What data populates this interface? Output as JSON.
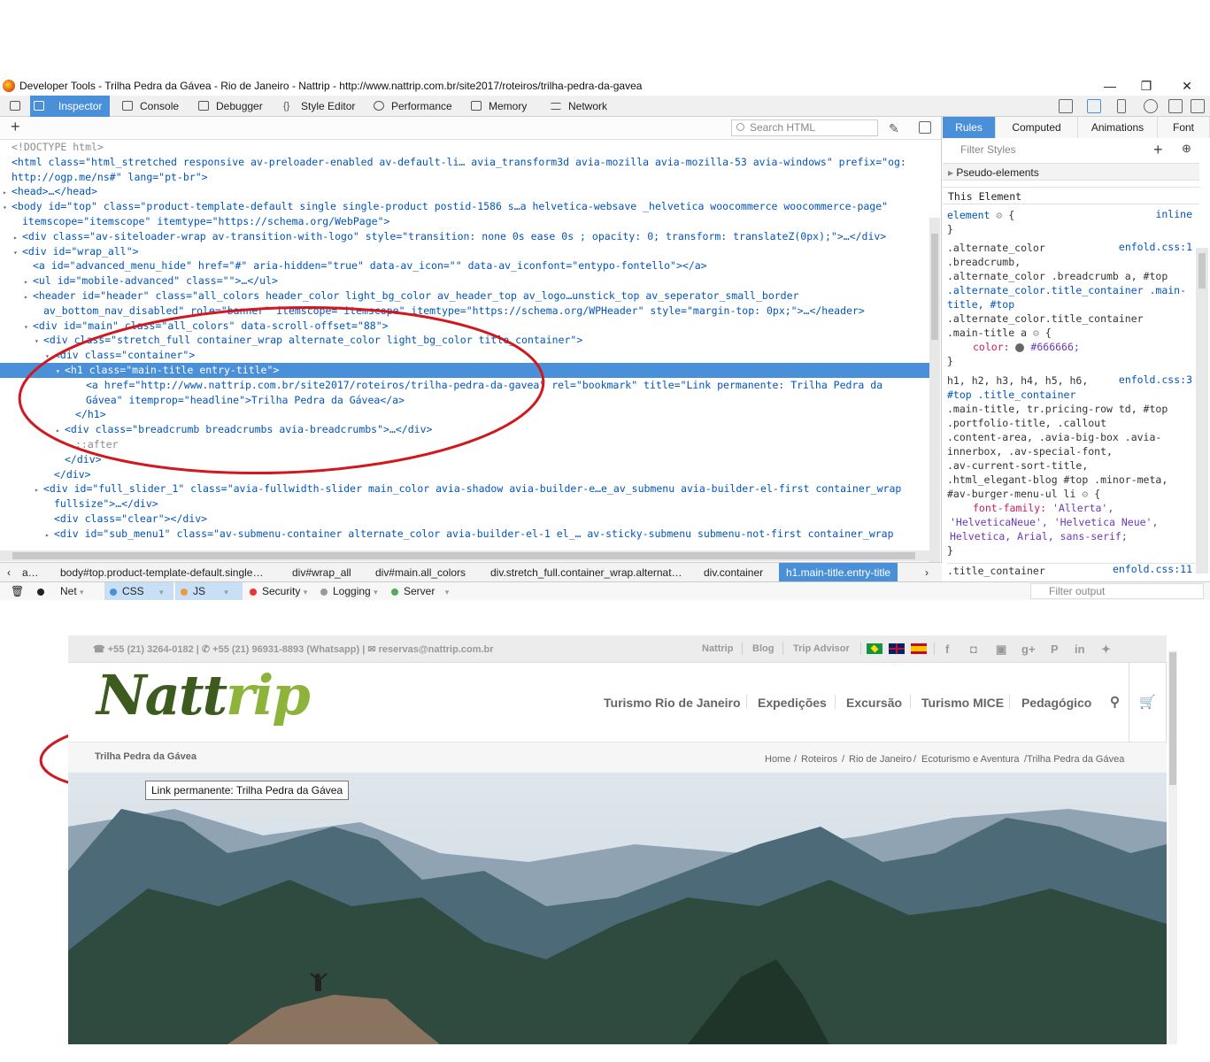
{
  "window": {
    "title": "Developer Tools - Trilha Pedra da Gávea - Rio de Janeiro - Nattrip - http://www.nattrip.com.br/site2017/roteiros/trilha-pedra-da-gavea"
  },
  "tabs": [
    "Inspector",
    "Console",
    "Debugger",
    "Style Editor",
    "Performance",
    "Memory",
    "Network"
  ],
  "markup": {
    "search_placeholder": "Search HTML",
    "lines": [
      {
        "t": "<!DOCTYPE html>"
      },
      {
        "t": "<html class=\"html_stretched responsive av-preloader-enabled av-default-li… avia_transform3d avia-mozilla avia-mozilla-53 avia-windows\" prefix=\"og:"
      },
      {
        "t": "http://ogp.me/ns#\" lang=\"pt-br\">"
      },
      {
        "t": "<head>…</head>"
      },
      {
        "t": "<body id=\"top\" class=\"product-template-default single single-product postid-1586 s…a helvetica-websave _helvetica woocommerce woocommerce-page\""
      },
      {
        "t": "itemscope=\"itemscope\" itemtype=\"https://schema.org/WebPage\">"
      },
      {
        "t": "<div class=\"av-siteloader-wrap av-transition-with-logo\" style=\"transition: none 0s ease 0s ; opacity: 0; transform: translateZ(0px);\">…</div>"
      },
      {
        "t": "<div id=\"wrap_all\">"
      },
      {
        "t": "<a id=\"advanced_menu_hide\" href=\"#\" aria-hidden=\"true\" data-av_icon=\"\" data-av_iconfont=\"entypo-fontello\"></a>"
      },
      {
        "t": "<ul id=\"mobile-advanced\" class=\"\">…</ul>"
      },
      {
        "t": "<header id=\"header\" class=\"all_colors header_color light_bg_color av_header_top av_logo…unstick_top av_seperator_small_border"
      },
      {
        "t": "av_bottom_nav_disabled\" role=\"banner\" itemscope=\"itemscope\" itemtype=\"https://schema.org/WPHeader\" style=\"margin-top: 0px;\">…</header>"
      },
      {
        "t": "<div id=\"main\" class=\"all_colors\" data-scroll-offset=\"88\">"
      },
      {
        "t": "<div class=\"stretch_full container_wrap alternate_color light_bg_color title_container\">"
      },
      {
        "t": "<div class=\"container\">"
      },
      {
        "t": "<h1 class=\"main-title entry-title\">"
      },
      {
        "t": "<a href=\"http://www.nattrip.com.br/site2017/roteiros/trilha-pedra-da-gavea\" rel=\"bookmark\" title=\"Link permanente: Trilha Pedra da"
      },
      {
        "t": "Gávea\" itemprop=\"headline\">Trilha Pedra da Gávea</a>"
      },
      {
        "t": "</h1>"
      },
      {
        "t": "<div class=\"breadcrumb breadcrumbs avia-breadcrumbs\">…</div>"
      },
      {
        "t": "::after"
      },
      {
        "t": "</div>"
      },
      {
        "t": "</div>"
      },
      {
        "t": "<div id=\"full_slider_1\" class=\"avia-fullwidth-slider main_color avia-shadow avia-builder-e…e_av_submenu avia-builder-el-first container_wrap"
      },
      {
        "t": "fullsize\">…</div>"
      },
      {
        "t": "<div class=\"clear\"></div>"
      },
      {
        "t": "<div id=\"sub_menu1\" class=\"av-submenu-container alternate_color avia-builder-el-1 el_… av-sticky-submenu submenu-not-first container_wrap"
      }
    ]
  },
  "rules": {
    "tabs": [
      "Rules",
      "Computed",
      "Animations",
      "Font"
    ],
    "filter_placeholder": "Filter Styles",
    "pseudo": "Pseudo-elements",
    "this_element": "This Element",
    "element": "element",
    "inline": "inline",
    "r1_src": "enfold.css:1",
    "r1_sel": [
      ".alternate_color",
      ".breadcrumb,",
      ".alternate_color .breadcrumb a, #top",
      ".alternate_color.title_container .main-",
      "title, #top",
      ".alternate_color.title_container",
      ".main-title a"
    ],
    "r1_prop": "color:",
    "r1_val": "#666666;",
    "r2_src": "enfold.css:3",
    "r2_sel": [
      "h1, h2, h3, h4, h5, h6,",
      "#top .title_container",
      ".main-title, tr.pricing-row td, #top",
      ".portfolio-title, .callout",
      ".content-area, .avia-big-box .avia-",
      "innerbox, .av-special-font,",
      ".av-current-sort-title,",
      ".html_elegant-blog #top .minor-meta,",
      "#av-burger-menu-ul li"
    ],
    "r2_prop": "font-family:",
    "r2_val": [
      "'Allerta',",
      "'HelveticaNeue', 'Helvetica Neue',",
      "Helvetica, Arial, sans-serif;"
    ],
    "r3_sel": ".title_container",
    "r3_src": "enfold.css:11"
  },
  "crumbs": [
    "a…",
    "body#top.product-template-default.single…",
    "div#wrap_all",
    "div#main.all_colors",
    "div.stretch_full.container_wrap.alternat…",
    "div.container",
    "h1.main-title.entry-title"
  ],
  "console": {
    "filters": [
      "Net",
      "CSS",
      "JS",
      "Security",
      "Logging",
      "Server"
    ],
    "filter_placeholder": "Filter output"
  },
  "site": {
    "contact": "☎ +55 (21) 3264-0182 | ✆ +55 (21) 96931-8893 (Whatsapp) | ✉ reservas@nattrip.com.br",
    "top_links": [
      "Nattrip",
      "Blog",
      "Trip Advisor"
    ],
    "logo_a": "Natt",
    "logo_b": "rip",
    "nav": [
      "Turismo Rio de Janeiro",
      "Expedições",
      "Excursão",
      "Turismo MICE",
      "Pedagógico"
    ],
    "page_title": "Trilha Pedra da Gávea",
    "breadcrumb": [
      "Home",
      "/",
      "Roteiros",
      "/",
      "Rio de Janeiro",
      "/",
      "Ecoturismo e Aventura",
      "/Trilha Pedra da Gávea"
    ],
    "tooltip": "Link permanente: Trilha Pedra da Gávea"
  },
  "colors": {
    "accent": "#4a90d9",
    "annotation": "#d0181e",
    "logo_dark": "#3d5a1f",
    "logo_light": "#8db33a"
  }
}
